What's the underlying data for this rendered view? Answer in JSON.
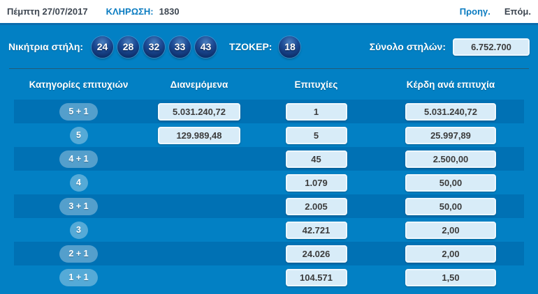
{
  "topbar": {
    "date": "Πέμπτη 27/07/2017",
    "draw_label": "ΚΛΗΡΩΣΗ:",
    "draw_number": "1830",
    "prev_label": "Προηγ.",
    "next_label": "Επόμ."
  },
  "winning": {
    "label": "Νικήτρια στήλη:",
    "numbers": [
      "24",
      "28",
      "32",
      "33",
      "43"
    ],
    "joker_label": "ΤΖΟΚΕΡ:",
    "joker": "18",
    "total_label": "Σύνολο στηλών:",
    "total_value": "6.752.700"
  },
  "table": {
    "headers": [
      "Κατηγορίες επιτυχιών",
      "Διανεμόμενα",
      "Επιτυχίες",
      "Κέρδη ανά επιτυχία"
    ],
    "rows": [
      {
        "category": "5 + 1",
        "distributed": "5.031.240,72",
        "winners": "1",
        "prize": "5.031.240,72"
      },
      {
        "category": "5",
        "distributed": "129.989,48",
        "winners": "5",
        "prize": "25.997,89"
      },
      {
        "category": "4 + 1",
        "distributed": "",
        "winners": "45",
        "prize": "2.500,00"
      },
      {
        "category": "4",
        "distributed": "",
        "winners": "1.079",
        "prize": "50,00"
      },
      {
        "category": "3 + 1",
        "distributed": "",
        "winners": "2.005",
        "prize": "50,00"
      },
      {
        "category": "3",
        "distributed": "",
        "winners": "42.721",
        "prize": "2,00"
      },
      {
        "category": "2 + 1",
        "distributed": "",
        "winners": "24.026",
        "prize": "2,00"
      },
      {
        "category": "1 + 1",
        "distributed": "",
        "winners": "104.571",
        "prize": "1,50"
      }
    ]
  },
  "colors": {
    "panel_bg": "#0280c4",
    "row_dark": "#0071b4",
    "value_box_bg": "#d8ecf8",
    "link_blue": "#0b7cc1",
    "text_dark": "#3e4752",
    "ball_navy": "#0d2f6b"
  }
}
